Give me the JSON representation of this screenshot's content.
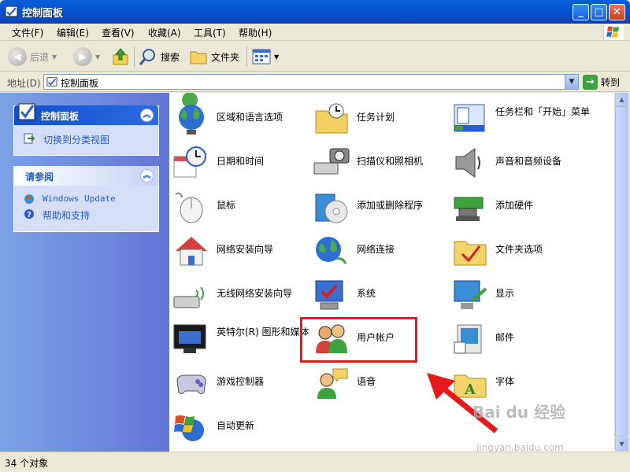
{
  "window": {
    "title": "控制面板"
  },
  "menu": [
    "文件(F)",
    "编辑(E)",
    "查看(V)",
    "收藏(A)",
    "工具(T)",
    "帮助(H)"
  ],
  "toolbar": {
    "back_label": "后退",
    "search_label": "搜索",
    "folders_label": "文件夹"
  },
  "address": {
    "label": "地址(D)",
    "value": "控制面板",
    "go_label": "转到"
  },
  "sidebar": {
    "panel1": {
      "title": "控制面板",
      "links": [
        "切换到分类视图"
      ]
    },
    "panel2": {
      "title": "请参阅",
      "links": [
        "Windows Update",
        "帮助和支持"
      ]
    }
  },
  "items": [
    "区域和语言选项",
    "任务计划",
    "任务栏和「开始」菜单",
    "日期和时间",
    "扫描仪和照相机",
    "声音和音频设备",
    "鼠标",
    "添加或删除程序",
    "添加硬件",
    "网络安装向导",
    "网络连接",
    "文件夹选项",
    "无线网络安装向导",
    "系统",
    "显示",
    "英特尔(R) 图形和媒体",
    "用户帐户",
    "邮件",
    "游戏控制器",
    "语音",
    "字体",
    "自动更新"
  ],
  "status": {
    "text": "34 个对象"
  },
  "watermark": {
    "main": "Bai du 经验",
    "sub": "jingyan.baidu.com"
  },
  "colors": {
    "highlight": "#e8191d",
    "title_bar": "#0a5fd8"
  }
}
